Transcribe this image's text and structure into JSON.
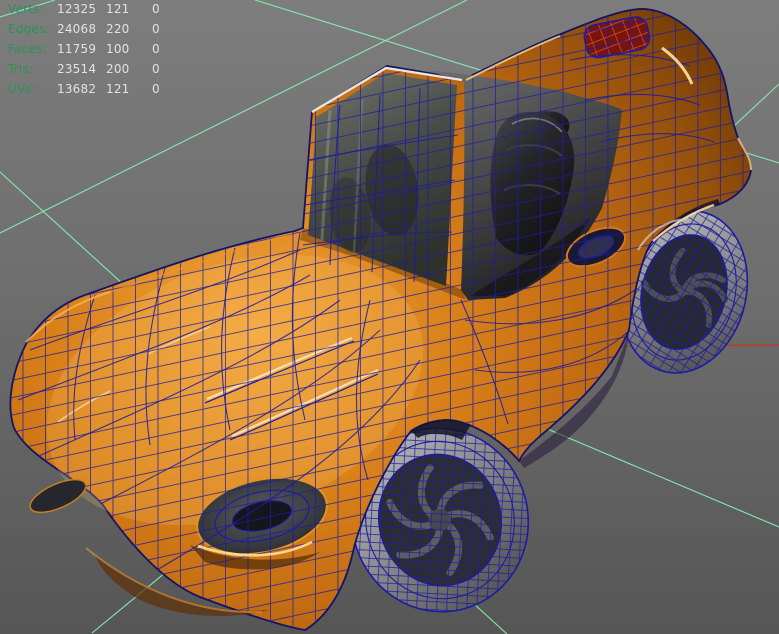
{
  "hud": {
    "rows": [
      {
        "label": "Verts:",
        "values": [
          "12325",
          "121",
          "0"
        ]
      },
      {
        "label": "Edges:",
        "values": [
          "24068",
          "220",
          "0"
        ]
      },
      {
        "label": "Faces:",
        "values": [
          "11759",
          "100",
          "0"
        ]
      },
      {
        "label": "Tris:",
        "values": [
          "23514",
          "200",
          "0"
        ]
      },
      {
        "label": "UVs:",
        "values": [
          "13682",
          "121",
          "0"
        ]
      }
    ]
  },
  "colors": {
    "bg_top": "#7d7d7d",
    "bg_bottom": "#565656",
    "hud_label": "#2a9455",
    "hud_value": "#e2e2e2",
    "grid_green": "#84e9ae",
    "axis_red": "#b04228",
    "wire_blue": "#1c1ca2",
    "body_orange": "#d27a16",
    "body_highlight": "#f4ab42",
    "body_shadow": "#7c3c08",
    "glass_gray": "#565852",
    "seat_black": "#1d1d20",
    "tire_gray": "#a9a9a9",
    "trunk_patch_red": "#78140c"
  }
}
